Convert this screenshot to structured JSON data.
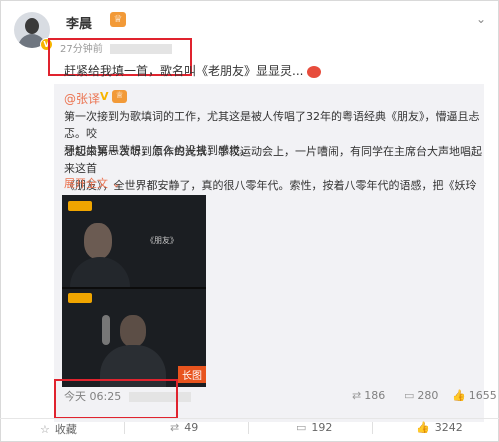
{
  "post": {
    "author": "李晨",
    "time": "27分钟前",
    "text": "赶紧给我填一首，歌名叫《老朋友》显显灵..."
  },
  "repost": {
    "author": "@张译",
    "paragraph1_line1": "第一次接到为歌填词的工作，尤其这是被人传唱了32年的粤语经典《朋友》，懵逼且忐忑。咬",
    "paragraph1_line2": "牙切齿冥思苦想，怎么也没找到感觉。",
    "paragraph2_line1": "想起来第一次听到原作的光景：学校运动会上，一片嘈闹，有同学在主席台大声地唱起来这首",
    "paragraph2_line2": "《朋友》，全世界都安静了，真的很八零年代。索性，按着八零年代的语感，把《妖玲玲》",
    "expand": "展开全文",
    "video": {
      "song_title": "《朋友》",
      "long_badge": "长图"
    },
    "time": "今天 06:25",
    "reposts": "186",
    "comments": "280",
    "likes": "1655"
  },
  "actions": {
    "favorite": "收藏",
    "repost": "49",
    "comment": "192",
    "like": "3242"
  },
  "colors": {
    "highlight_box": "#e0232e",
    "link_orange": "#eb7350",
    "verified": "#f7b500"
  },
  "icons": [
    "verified-icon",
    "rank-badge-icon",
    "chevron-down-icon",
    "repost-icon",
    "comment-icon",
    "like-icon",
    "favorite-icon"
  ]
}
